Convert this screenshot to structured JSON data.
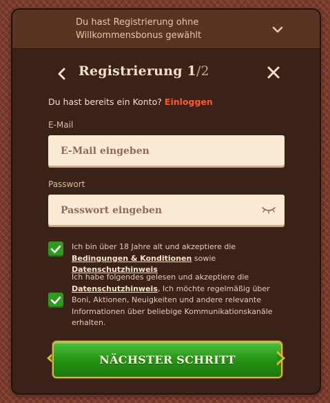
{
  "bonus_bar": {
    "text_line1": "Du hast Registrierung ohne",
    "text_line2": "Willkommensbonus gewählt",
    "chevron_icon": "chevron-down-icon"
  },
  "header": {
    "title": "Registrierung",
    "step": "1",
    "step_total": "/2",
    "back_icon": "chevron-left-icon",
    "close_icon": "close-icon"
  },
  "login": {
    "prompt": "Du hast bereits ein Konto?",
    "link": "Einloggen"
  },
  "email": {
    "label": "E-Mail",
    "placeholder": "E-Mail eingeben",
    "value": ""
  },
  "password": {
    "label": "Passwort",
    "placeholder": "Passwort eingeben",
    "value": "",
    "toggle_icon": "eye-closed-icon"
  },
  "consent_terms": {
    "checked": true,
    "text_before": "Ich bin über 18 Jahre alt und akzeptiere die",
    "link1": "Bedingungen & Konditionen",
    "text_middle": "sowie",
    "link2": "Datenschutzhinweis"
  },
  "consent_marketing": {
    "checked": true,
    "text_before": "Ich habe folgendes gelesen und akzeptiere die",
    "link": "Datenschutzhinweis",
    "text_after": ", Ich möchte regelmäßig über Boni, Aktionen, Neuigkeiten und andere relevante Informationen über beliebige Kommunikationskanäle erhalten."
  },
  "next_button": {
    "label": "NÄCHSTER SCHRITT"
  },
  "colors": {
    "accent_link": "#ff5a2a",
    "button_green": "#239013",
    "button_border": "#e4b340",
    "panel_bg": "#3a2218",
    "input_bg": "#fbead3"
  }
}
